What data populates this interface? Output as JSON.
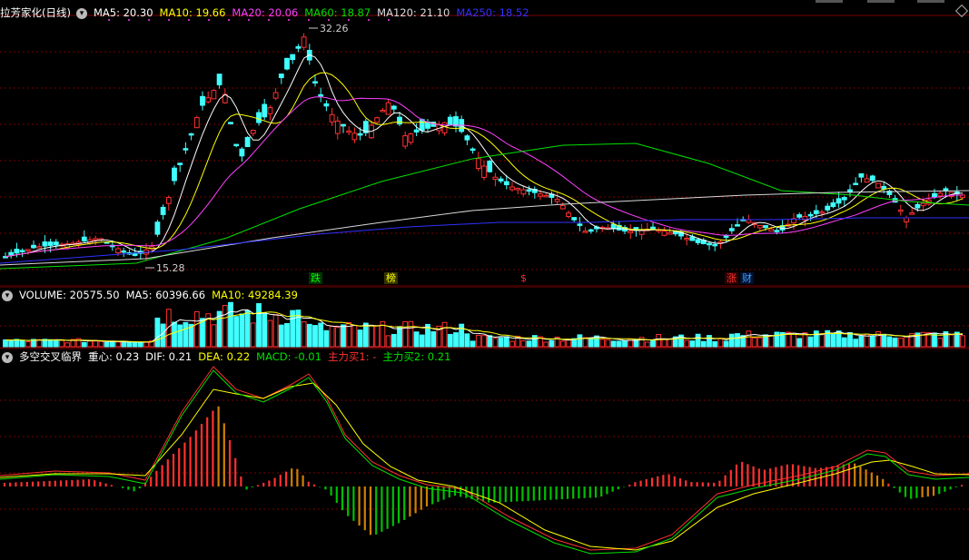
{
  "price_panel": {
    "stock_name": "拉芳家化(日线)",
    "ma_labels": [
      {
        "text": "MA5: 20.30",
        "color": "#ffffff"
      },
      {
        "text": "MA10: 19.66",
        "color": "#ffff00"
      },
      {
        "text": "MA20: 20.06",
        "color": "#ff40ff"
      },
      {
        "text": "MA60: 18.87",
        "color": "#00e000"
      },
      {
        "text": "MA120: 21.10",
        "color": "#dddddd"
      },
      {
        "text": "MA250: 18.52",
        "color": "#3030ff"
      }
    ],
    "high_label": "32.26",
    "low_label": "15.28",
    "signals": [
      {
        "text": "跌",
        "color": "#00ff00",
        "bg": "#003300"
      },
      {
        "text": "榜",
        "color": "#ffff00",
        "bg": "#333300"
      },
      {
        "text": "$",
        "color": "#ff3030",
        "bg": "transparent"
      },
      {
        "text": "涨",
        "color": "#ff3030",
        "bg": "#330000"
      },
      {
        "text": "财",
        "color": "#40a0ff",
        "bg": "#001030"
      }
    ]
  },
  "volume_panel": {
    "labels": [
      {
        "text": "VOLUME: 20575.50",
        "color": "#ffffff"
      },
      {
        "text": "MA5: 60396.66",
        "color": "#ffffff"
      },
      {
        "text": "MA10: 49284.39",
        "color": "#ffff00"
      }
    ]
  },
  "indicator_panel": {
    "labels": [
      {
        "text": "多空交叉临界",
        "color": "#ffffff"
      },
      {
        "text": "重心: 0.23",
        "color": "#ffffff"
      },
      {
        "text": "DIF: 0.21",
        "color": "#ffffff"
      },
      {
        "text": "DEA: 0.22",
        "color": "#ffff00"
      },
      {
        "text": "MACD: -0.01",
        "color": "#00e000"
      },
      {
        "text": "主力买1: -",
        "color": "#ff3030"
      },
      {
        "text": "主力买2: 0.21",
        "color": "#00e000"
      }
    ]
  },
  "colors": {
    "up": "#ff3030",
    "down": "#40ffff",
    "grid": "#7a0000",
    "bg": "#000000"
  }
}
